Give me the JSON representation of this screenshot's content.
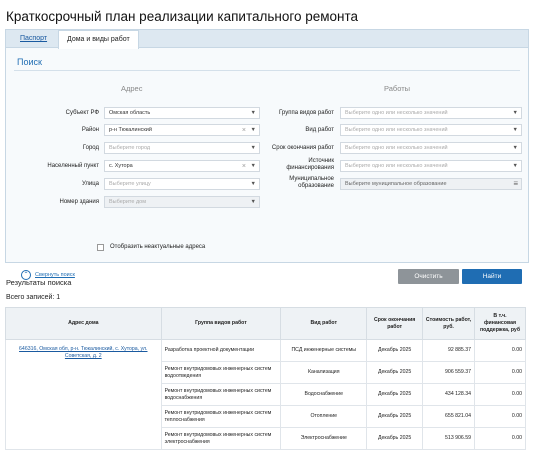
{
  "page": {
    "title": "Краткосрочный план реализации капитального ремонта"
  },
  "tabs": [
    {
      "label": "Паспорт"
    },
    {
      "label": "Дома и виды работ"
    }
  ],
  "search": {
    "title": "Поиск",
    "address_header": "Адрес",
    "works_header": "Работы",
    "subject": {
      "label": "Субъект РФ",
      "value": "Омская область"
    },
    "district": {
      "label": "Район",
      "value": "р-н Тюкалинский"
    },
    "city": {
      "label": "Город",
      "placeholder": "Выберите город"
    },
    "settlement": {
      "label": "Населенный пункт",
      "value": "с. Хутора"
    },
    "street": {
      "label": "Улица",
      "placeholder": "Выберите улицу"
    },
    "building": {
      "label": "Номер здания",
      "placeholder": "Выберите дом"
    },
    "inactive_checkbox_label": "Отобразить неактуальные адреса",
    "work_group": {
      "label": "Группа видов работ",
      "placeholder": "Выберите одно или несколько значений"
    },
    "work_type": {
      "label": "Вид работ",
      "placeholder": "Выберите одно или несколько значений"
    },
    "end_date": {
      "label": "Срок окончания работ",
      "placeholder": "Выберите одно или несколько значений"
    },
    "funding": {
      "label": "Источник финансирования",
      "placeholder": "Выберите одно или несколько значений"
    },
    "municipality": {
      "label": "Муниципальное образование",
      "placeholder": "Выберите муниципальное образование"
    },
    "collapse_label": "Свернуть поиск",
    "clear_label": "Очистить",
    "find_label": "Найти"
  },
  "results": {
    "title": "Результаты поиска",
    "total": "Всего записей: 1",
    "columns": [
      "Адрес дома",
      "Группа видов работ",
      "Вид работ",
      "Срок окончания работ",
      "Стоимость работ, руб.",
      "В т.ч. финансовая поддержка, руб"
    ],
    "address": "646316, Омская обл, р-н. Тюкалинский, с. Хутора, ул. Советская, д. 2",
    "rows": [
      {
        "group": "Разработка проектной документации",
        "type": "ПСД инженерные системы",
        "term": "Декабрь 2025",
        "cost": "92 885.37",
        "support": "0.00"
      },
      {
        "group": "Ремонт внутридомовых инженерных систем водоотведения",
        "type": "Канализация",
        "term": "Декабрь 2025",
        "cost": "906 559.37",
        "support": "0.00"
      },
      {
        "group": "Ремонт внутридомовых инженерных систем водоснабжения",
        "type": "Водоснабжение",
        "term": "Декабрь 2025",
        "cost": "434 128.34",
        "support": "0.00"
      },
      {
        "group": "Ремонт внутридомовых инженерных систем теплоснабжения",
        "type": "Отопление",
        "term": "Декабрь 2025",
        "cost": "655 821.04",
        "support": "0.00"
      },
      {
        "group": "Ремонт внутридомовых инженерных систем электроснабжения",
        "type": "Электроснабжение",
        "term": "Декабрь 2025",
        "cost": "513 906.59",
        "support": "0.00"
      }
    ]
  },
  "icons": {
    "dropdown": "chevron-down-icon",
    "clear": "close-icon",
    "menu": "menu-icon",
    "collapse": "chevron-up-icon"
  }
}
